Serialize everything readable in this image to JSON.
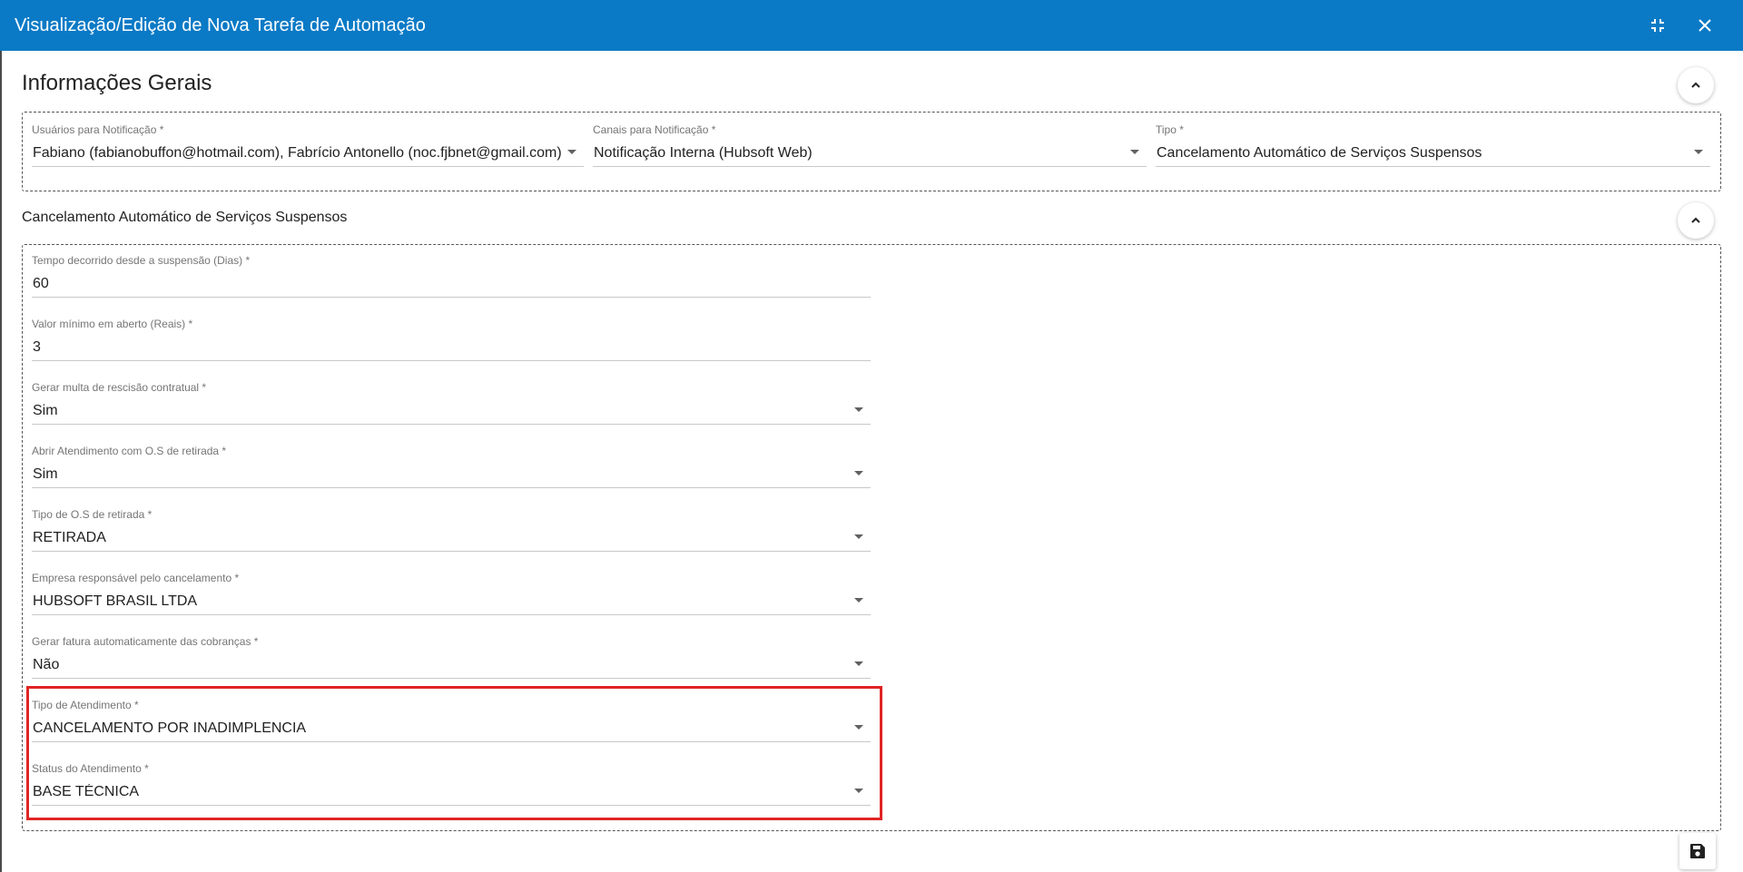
{
  "window": {
    "title": "Visualização/Edição de Nova Tarefa de Automação",
    "icons": {
      "exit_fullscreen": "exit-fullscreen-icon",
      "close": "close-icon"
    }
  },
  "general": {
    "title": "Informações Gerais",
    "fields": {
      "users": {
        "label": "Usuários para Notificação *",
        "value": "Fabiano (fabianobuffon@hotmail.com), Fabrício Antonello (noc.fjbnet@gmail.com),"
      },
      "channels": {
        "label": "Canais para Notificação *",
        "value": "Notificação Interna (Hubsoft Web)"
      },
      "type": {
        "label": "Tipo *",
        "value": "Cancelamento Automático de Serviços Suspensos"
      }
    }
  },
  "cancel_section": {
    "title": "Cancelamento Automático de Serviços Suspensos",
    "fields": {
      "elapsed": {
        "label": "Tempo decorrido desde a suspensão (Dias) *",
        "value": "60"
      },
      "min_value": {
        "label": "Valor mínimo em aberto (Reais) *",
        "value": "3"
      },
      "fine": {
        "label": "Gerar multa de rescisão contratual *",
        "value": "Sim"
      },
      "open_ticket": {
        "label": "Abrir Atendimento com O.S de retirada *",
        "value": "Sim"
      },
      "os_type": {
        "label": "Tipo de O.S de retirada *",
        "value": "RETIRADA"
      },
      "company": {
        "label": "Empresa responsável pelo cancelamento *",
        "value": "HUBSOFT BRASIL LTDA"
      },
      "invoice": {
        "label": "Gerar fatura automaticamente das cobranças *",
        "value": "Não"
      },
      "ticket_type": {
        "label": "Tipo de Atendimento *",
        "value": "CANCELAMENTO POR INADIMPLENCIA"
      },
      "ticket_status": {
        "label": "Status do Atendimento *",
        "value": "BASE TÉCNICA"
      }
    }
  },
  "colors": {
    "titlebar": "#0a7ac6",
    "highlight": "#e02424"
  }
}
